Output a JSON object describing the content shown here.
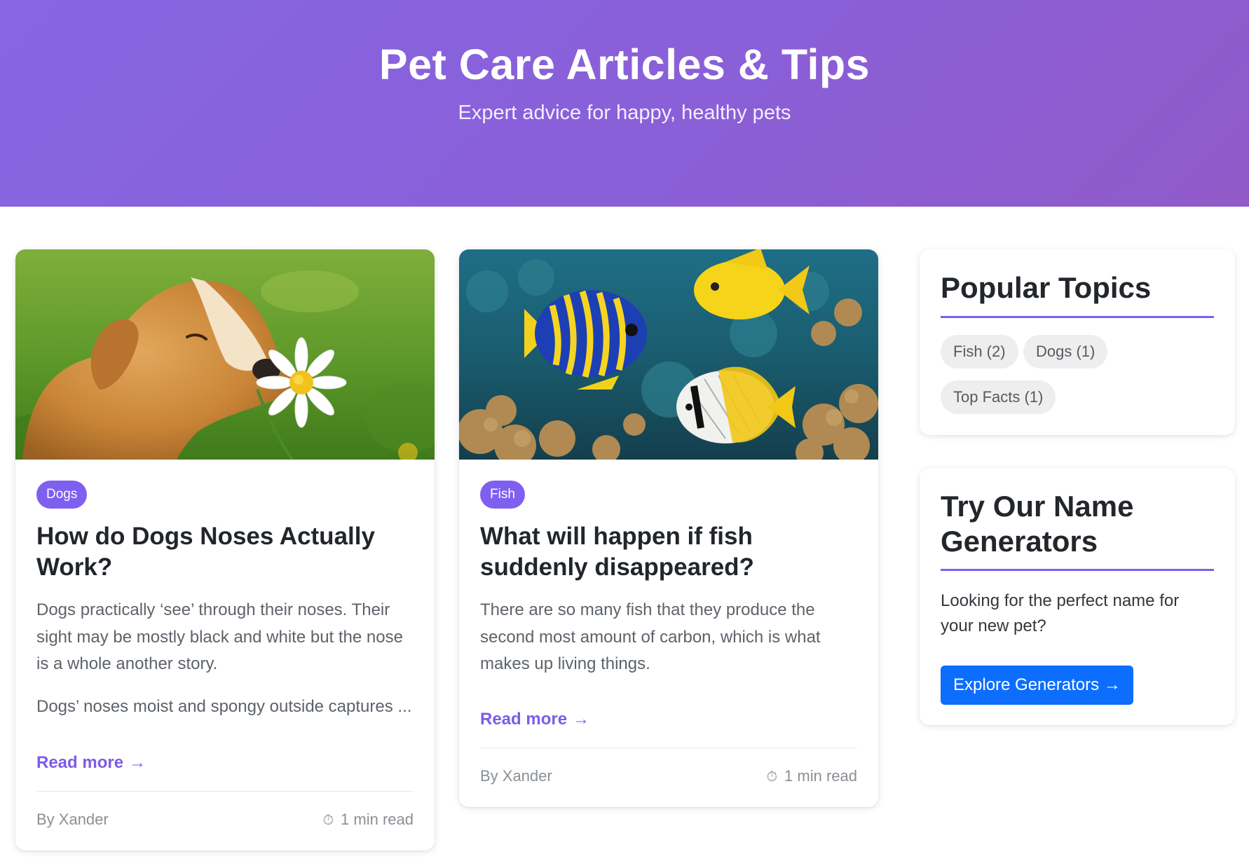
{
  "hero": {
    "title": "Pet Care Articles & Tips",
    "subtitle": "Expert advice for happy, healthy pets"
  },
  "articles": [
    {
      "image": "puppy-smelling-daisy",
      "category": "Dogs",
      "title": "How do Dogs Noses Actually Work?",
      "excerpt": "Dogs practically ‘see’ through their noses. Their sight may be mostly black and white but the nose is a whole another story.",
      "excerpt_more": "Dogs’ noses moist and spongy outside captures ...",
      "read_more": "Read more",
      "read_more_arrow": "→",
      "author": "By Xander",
      "read_time": "1 min read",
      "timer_icon": "⏱"
    },
    {
      "image": "tropical-fish-coral-reef",
      "category": "Fish",
      "title": "What will happen if fish suddenly disappeared?",
      "excerpt": "There are so many fish that they produce the second most amount of carbon, which is what makes up living things.",
      "read_more": "Read more",
      "read_more_arrow": "→",
      "author": "By Xander",
      "read_time": "1 min read",
      "timer_icon": "⏱"
    }
  ],
  "sidebar": {
    "popular": {
      "title": "Popular Topics",
      "topics": [
        "Fish (2)",
        "Dogs (1)",
        "Top Facts (1)"
      ]
    },
    "generators": {
      "title": "Try Our Name Generators",
      "text": "Looking for the perfect name for your new pet?",
      "button": "Explore Generators →"
    }
  },
  "colors": {
    "accent": "#7f5ff0",
    "hero_gradient_start": "#8666e3",
    "hero_gradient_end": "#915ac8",
    "button": "#0d6efd"
  }
}
